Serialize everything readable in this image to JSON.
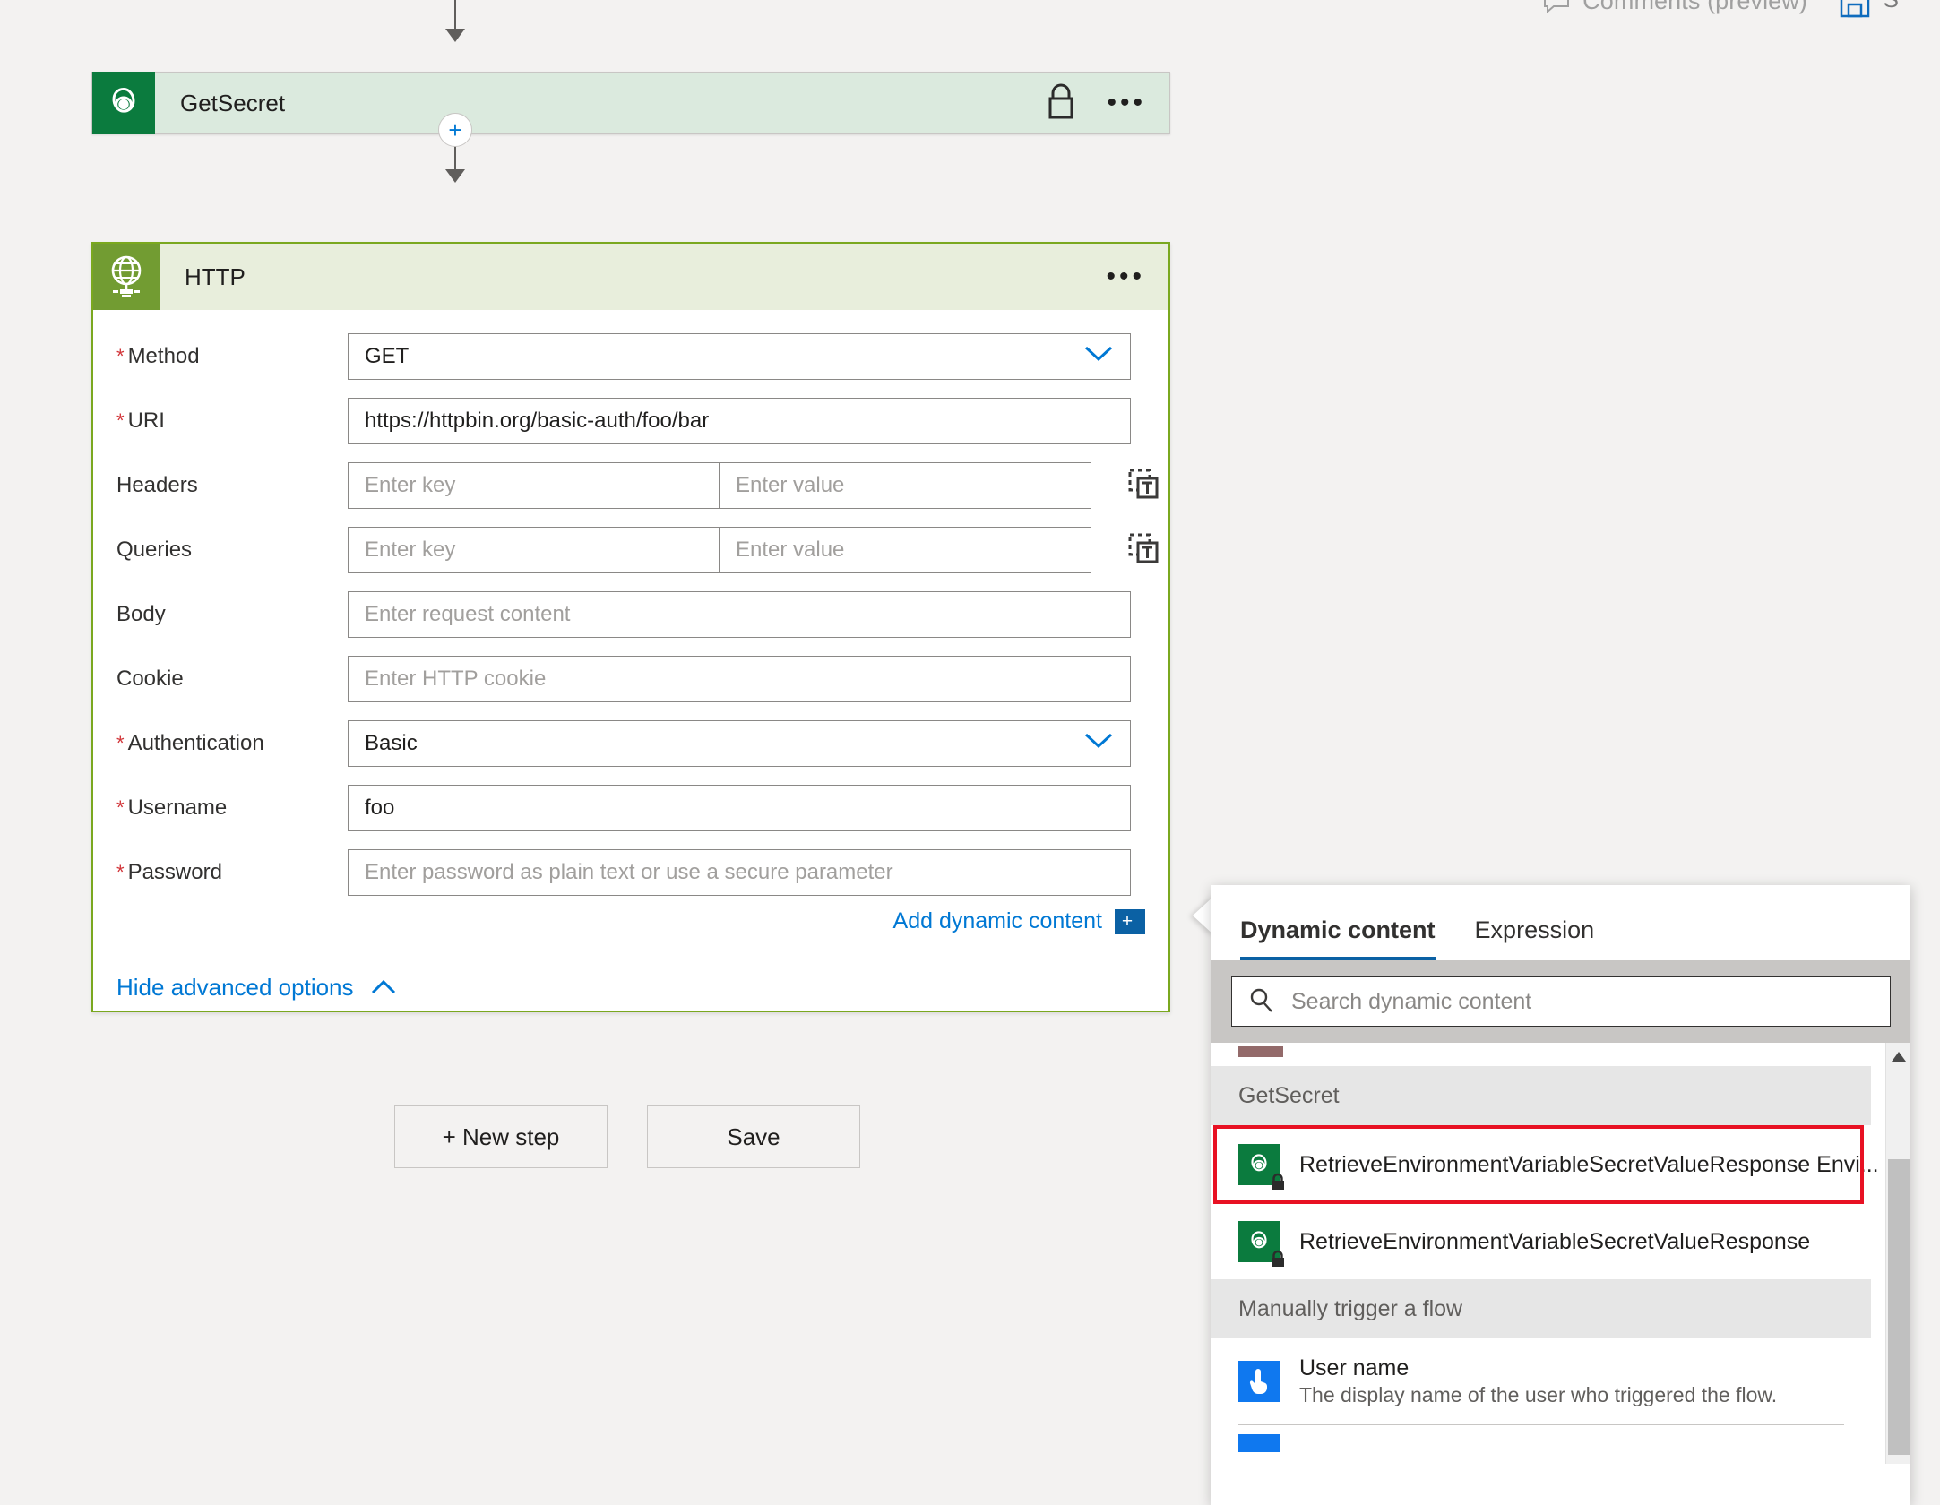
{
  "topbar": {
    "comments_label": "Comments (preview)",
    "comment_icon": "comment-bubble-icon",
    "save_icon": "save-disk-icon"
  },
  "flow": {
    "steps": [
      {
        "title": "GetSecret",
        "icon": "dataverse-icon",
        "accent": "#0b7b3e",
        "header_bg": "#dbeade",
        "locked": true,
        "lock_icon": "lock-icon",
        "menu_icon": "ellipsis-icon"
      },
      {
        "title": "HTTP",
        "icon": "globe-network-icon",
        "accent": "#729c32",
        "header_bg": "#e8eedc",
        "locked": false,
        "menu_icon": "ellipsis-icon"
      }
    ],
    "insert_button_label": "+"
  },
  "http_form": {
    "fields": [
      {
        "label": "Method",
        "required": true,
        "control": "dropdown",
        "value": "GET",
        "placeholder": ""
      },
      {
        "label": "URI",
        "required": true,
        "control": "text",
        "value": "https://httpbin.org/basic-auth/foo/bar",
        "placeholder": ""
      },
      {
        "label": "Headers",
        "required": false,
        "control": "keyvalue",
        "key_placeholder": "Enter key",
        "value_placeholder": "Enter value",
        "switch_icon": "switch-to-text-mode-icon"
      },
      {
        "label": "Queries",
        "required": false,
        "control": "keyvalue",
        "key_placeholder": "Enter key",
        "value_placeholder": "Enter value",
        "switch_icon": "switch-to-text-mode-icon"
      },
      {
        "label": "Body",
        "required": false,
        "control": "text",
        "value": "",
        "placeholder": "Enter request content"
      },
      {
        "label": "Cookie",
        "required": false,
        "control": "text",
        "value": "",
        "placeholder": "Enter HTTP cookie"
      },
      {
        "label": "Authentication",
        "required": true,
        "control": "dropdown",
        "value": "Basic",
        "placeholder": ""
      },
      {
        "label": "Username",
        "required": true,
        "control": "text",
        "value": "foo",
        "placeholder": ""
      },
      {
        "label": "Password",
        "required": true,
        "control": "text",
        "value": "",
        "placeholder": "Enter password as plain text or use a secure parameter"
      }
    ],
    "add_dynamic_content": "Add dynamic content",
    "add_dynamic_plus": "+",
    "advanced_toggle": "Hide advanced options",
    "advanced_chevron": "chevron-up-icon"
  },
  "actions": {
    "new_step": "+ New step",
    "save": "Save"
  },
  "dynamic_panel": {
    "tabs": [
      {
        "label": "Dynamic content",
        "active": true
      },
      {
        "label": "Expression",
        "active": false
      }
    ],
    "search_placeholder": "Search dynamic content",
    "search_value": "",
    "search_icon": "search-icon",
    "groups": [
      {
        "name": "GetSecret",
        "items": [
          {
            "title": "RetrieveEnvironmentVariableSecretValueResponse Envi...",
            "subtitle": "",
            "icon": "dataverse-secure-icon",
            "icon_color": "#0b7b3e",
            "highlighted": true
          },
          {
            "title": "RetrieveEnvironmentVariableSecretValueResponse",
            "subtitle": "",
            "icon": "dataverse-secure-icon",
            "icon_color": "#0b7b3e",
            "highlighted": false
          }
        ]
      },
      {
        "name": "Manually trigger a flow",
        "items": [
          {
            "title": "User name",
            "subtitle": "The display name of the user who triggered the flow.",
            "icon": "manual-trigger-icon",
            "icon_color": "#0f78ef",
            "highlighted": false
          }
        ]
      }
    ],
    "highlight_color": "#e81123",
    "scrollbar": {
      "up_icon": "scroll-up-arrow-icon"
    }
  }
}
